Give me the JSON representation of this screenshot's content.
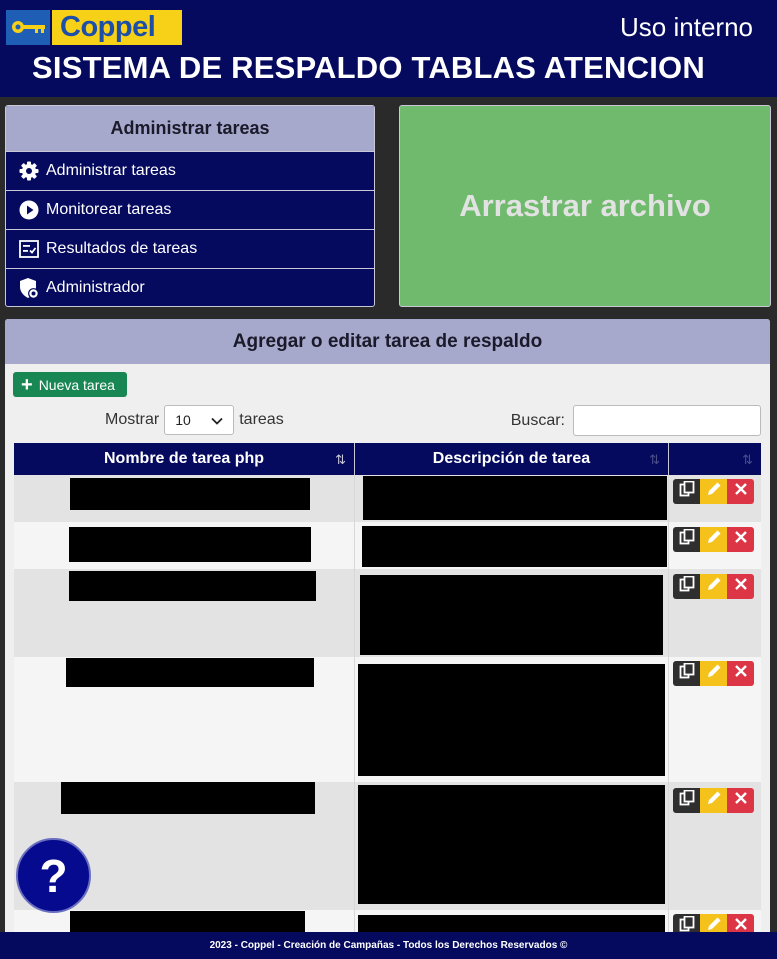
{
  "header": {
    "logo_text": "Coppel",
    "internal_label": "Uso interno",
    "system_title": "SISTEMA DE RESPALDO TABLAS ATENCION"
  },
  "menu": {
    "title": "Administrar tareas",
    "items": [
      {
        "label": "Administrar tareas",
        "icon": "gear-icon"
      },
      {
        "label": "Monitorear tareas",
        "icon": "play-circle-icon"
      },
      {
        "label": "Resultados de tareas",
        "icon": "checklist-icon"
      },
      {
        "label": "Administrador",
        "icon": "shield-user-icon"
      }
    ]
  },
  "dropzone": {
    "label": "Arrastrar archivo"
  },
  "card": {
    "title": "Agregar o editar tarea de respaldo",
    "new_button": "Nueva tarea",
    "show_label": "Mostrar",
    "page_size": "10",
    "tasks_label": "tareas",
    "search_label": "Buscar:",
    "search_value": ""
  },
  "table": {
    "columns": [
      "Nombre de tarea php",
      "Descripción de tarea",
      ""
    ],
    "rows": [
      {
        "name": "[redacted]",
        "description": "[redacted]"
      },
      {
        "name": "[redacted]",
        "description": "[redacted]"
      },
      {
        "name": "[redacted]",
        "description": "[redacted]"
      },
      {
        "name": "[redacted]",
        "description": "[redacted]"
      },
      {
        "name": "[redacted]",
        "description": "[redacted]"
      },
      {
        "name": "[redacted]",
        "description": "[redacted]"
      }
    ]
  },
  "help_label": "?",
  "footer": "2023 - Coppel - Creación de Campañas - Todos los Derechos Reservados ©",
  "colors": {
    "navy": "#050a5e",
    "lavender": "#a6a8cc",
    "green_drop": "#6fba6d",
    "new_button": "#198754",
    "edit": "#f5c21c",
    "delete": "#dc3545",
    "logo_yellow": "#f7d117"
  }
}
